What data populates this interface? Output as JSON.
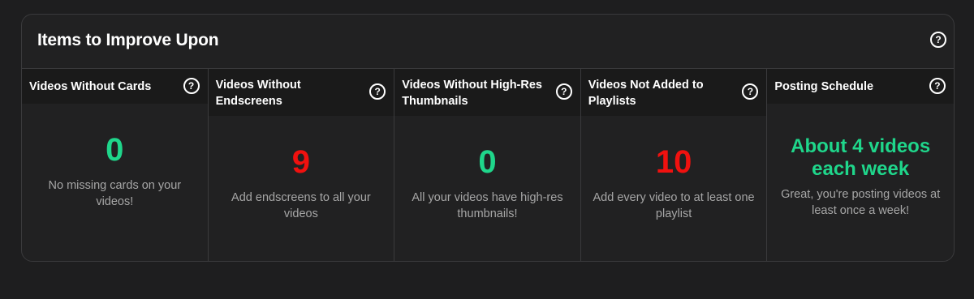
{
  "card": {
    "title": "Items to Improve Upon",
    "help_glyph": "?"
  },
  "columns": [
    {
      "title": "Videos Without Cards",
      "value": "0",
      "status": "good",
      "description": "No missing cards on your videos!"
    },
    {
      "title": "Videos Without Endscreens",
      "value": "9",
      "status": "bad",
      "description": "Add endscreens to all your videos"
    },
    {
      "title": "Videos Without High-Res Thumbnails",
      "value": "0",
      "status": "good",
      "description": "All your videos have high-res thumbnails!"
    },
    {
      "title": "Videos Not Added to Playlists",
      "value": "10",
      "status": "bad",
      "description": "Add every video to at least one playlist"
    },
    {
      "title": "Posting Schedule",
      "value": "About 4 videos each week",
      "status": "good",
      "description": "Great, you're posting videos at least once a week!"
    }
  ],
  "colors": {
    "good": "#1fd68b",
    "bad": "#f0110f",
    "background": "#1e1e1f",
    "card": "#212122"
  },
  "icons": {
    "help": "question-circle-icon"
  }
}
